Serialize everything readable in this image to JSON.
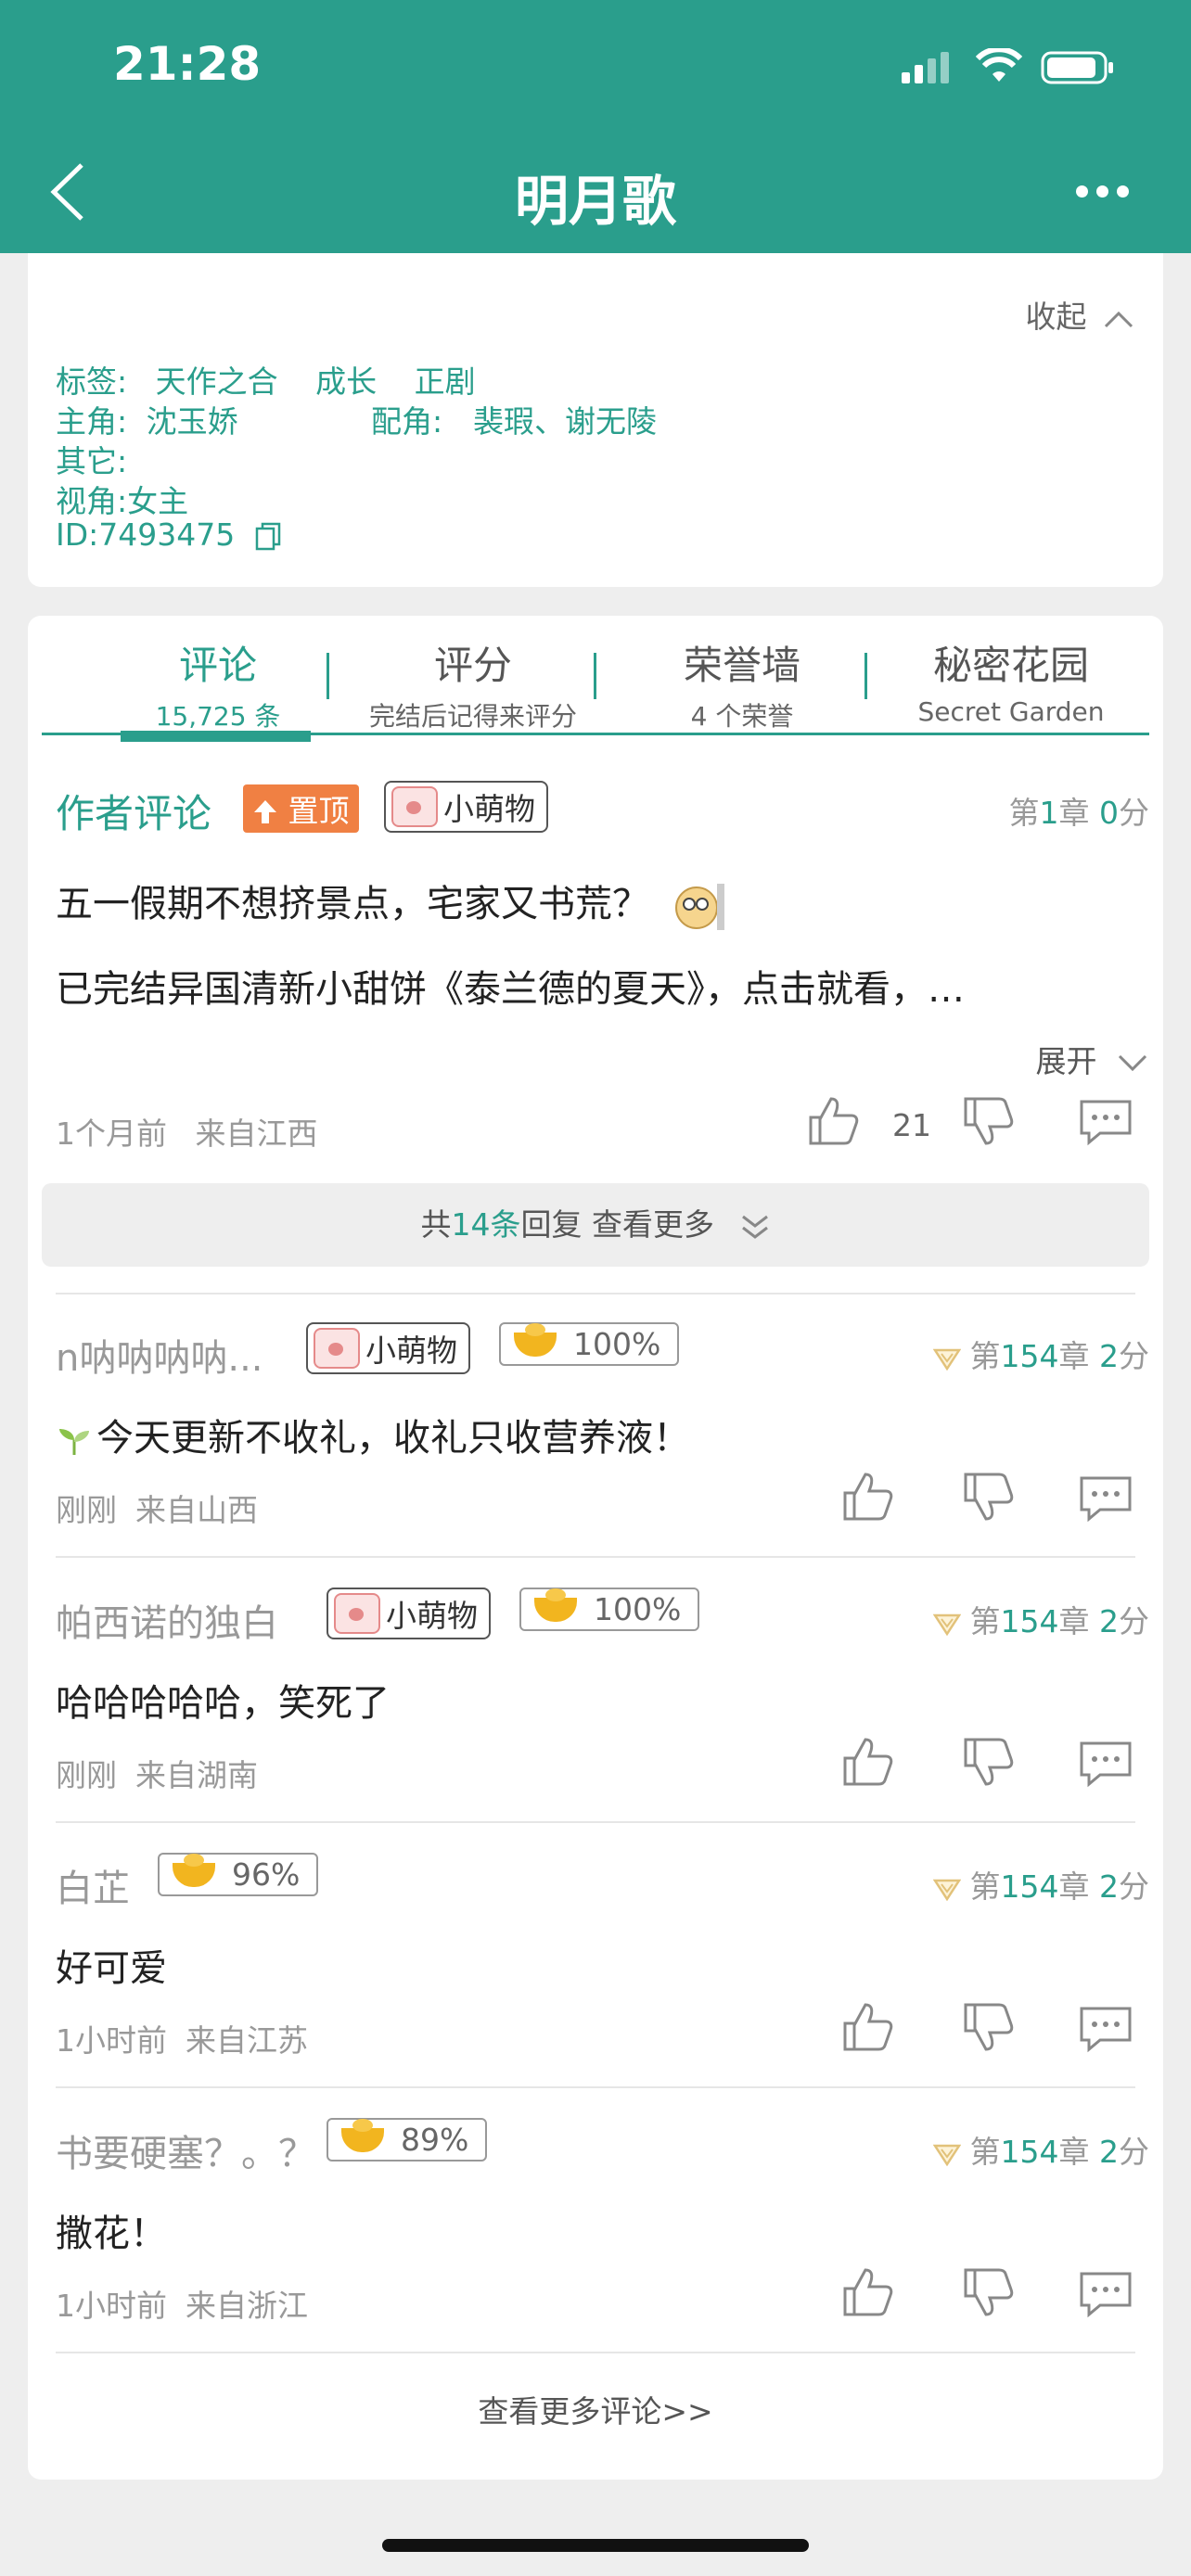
{
  "status_bar": {
    "time": "21:28"
  },
  "header": {
    "title": "明月歌"
  },
  "info": {
    "collapse_label": "收起",
    "tags_label": "标签:",
    "tags": [
      "天作之合",
      "成长",
      "正剧"
    ],
    "protagonist_label": "主角:",
    "protagonist": "沈玉娇",
    "supporting_label": "配角:",
    "supporting": "裴瑕、谢无陵",
    "other_label": "其它:",
    "perspective": "视角:女主",
    "id": "ID:7493475"
  },
  "tabs": [
    {
      "title": "评论",
      "sub": "15,725 条"
    },
    {
      "title": "评分",
      "sub": "完结后记得来评分"
    },
    {
      "title": "荣誉墙",
      "sub": "4 个荣誉"
    },
    {
      "title": "秘密花园",
      "sub": "Secret Garden"
    }
  ],
  "author_comment": {
    "label": "作者评论",
    "pinned": "置顶",
    "tag": "小萌物",
    "chapter_prefix": "第",
    "chapter": "1",
    "chapter_mid": "章",
    "score": "0",
    "score_suffix": "分",
    "line1": "五一假期不想挤景点，宅家又书荒？",
    "line2": "已完结异国清新小甜饼《泰兰德的夏天》，点击就看，…",
    "expand": "展开",
    "time": "1个月前",
    "location": "来自江西",
    "likes": "21"
  },
  "reply_bar": {
    "prefix": "共",
    "count": "14",
    "mid": "条",
    "suffix": "回复 查看更多"
  },
  "comments": [
    {
      "name": "n呐呐呐呐...",
      "tag": "小萌物",
      "gold": "100%",
      "chapter": "154",
      "score": "2",
      "text": "今天更新不收礼，收礼只收营养液！",
      "time": "刚刚",
      "location": "来自山西"
    },
    {
      "name": "帕西诺的独白",
      "tag": "小萌物",
      "gold": "100%",
      "chapter": "154",
      "score": "2",
      "text": "哈哈哈哈哈，笑死了",
      "time": "刚刚",
      "location": "来自湖南"
    },
    {
      "name": "白芷",
      "gold": "96%",
      "chapter": "154",
      "score": "2",
      "text": "好可爱",
      "time": "1小时前",
      "location": "来自江苏"
    },
    {
      "name": "书要硬塞？。？",
      "gold": "89%",
      "chapter": "154",
      "score": "2",
      "text": "撒花！",
      "time": "1小时前",
      "location": "来自浙江"
    }
  ],
  "chapter_prefix": "第",
  "chapter_mid": "章",
  "score_suffix": "分",
  "more_comments": "查看更多评论>>",
  "colors": {
    "brand": "#2a9e8c",
    "pinned": "#f08043",
    "gold": "#f2b51f"
  }
}
